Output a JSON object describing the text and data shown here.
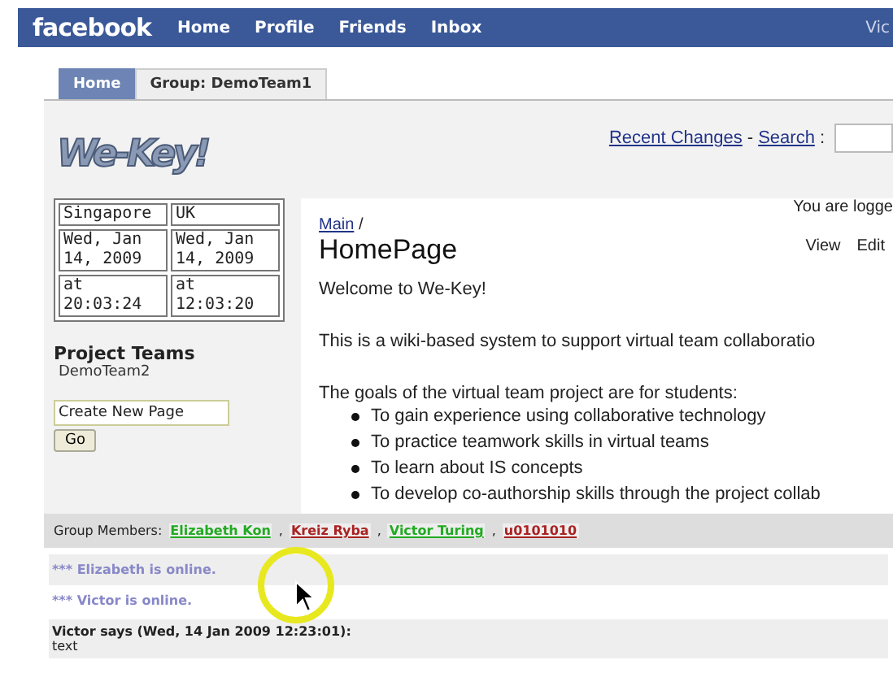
{
  "facebook_bar": {
    "logo": "facebook",
    "nav": [
      "Home",
      "Profile",
      "Friends",
      "Inbox"
    ],
    "user": "Vic"
  },
  "tabs": [
    {
      "label": "Home",
      "selected": true
    },
    {
      "label": "Group: DemoTeam1",
      "selected": false
    }
  ],
  "header": {
    "logo": "We-Key!",
    "recent_changes": "Recent Changes",
    "separator": "-",
    "search": "Search",
    "colon": ":"
  },
  "clocks": [
    {
      "city": "Singapore",
      "date": "Wed, Jan 14, 2009",
      "time": "at 20:03:24"
    },
    {
      "city": "UK",
      "date": "Wed, Jan 14, 2009",
      "time": "at 12:03:20"
    }
  ],
  "sidebar": {
    "title": "Project Teams",
    "teams": [
      "DemoTeam2"
    ],
    "new_page_value": "Create New Page",
    "go": "Go"
  },
  "main": {
    "breadcrumb": "Main",
    "breadcrumb_sep": "/",
    "title": "HomePage",
    "login": "You are logge",
    "actions": [
      "View",
      "Edit"
    ],
    "paragraphs": [
      "Welcome to We-Key!",
      "This is a wiki-based system to support virtual team collaboratio",
      "The goals of the virtual team project are for students:"
    ],
    "goals": [
      "To gain experience using collaborative technology",
      "To practice teamwork skills in virtual teams",
      "To learn about IS concepts",
      "To develop co-authorship skills through the project collab"
    ]
  },
  "group_members": {
    "label": "Group Members:",
    "separator": ",",
    "members": [
      {
        "name": "Elizabeth Kon",
        "color": "#22aa22"
      },
      {
        "name": "Kreiz Ryba",
        "color": "#aa2222"
      },
      {
        "name": "Victor Turing",
        "color": "#22aa22"
      },
      {
        "name": "u0101010",
        "color": "#aa2222"
      }
    ]
  },
  "chat": {
    "system": [
      "*** Elizabeth is online.",
      "*** Victor is online."
    ],
    "message": {
      "header": "Victor says (Wed, 14 Jan 2009 12:23:01):",
      "body": "text"
    }
  }
}
